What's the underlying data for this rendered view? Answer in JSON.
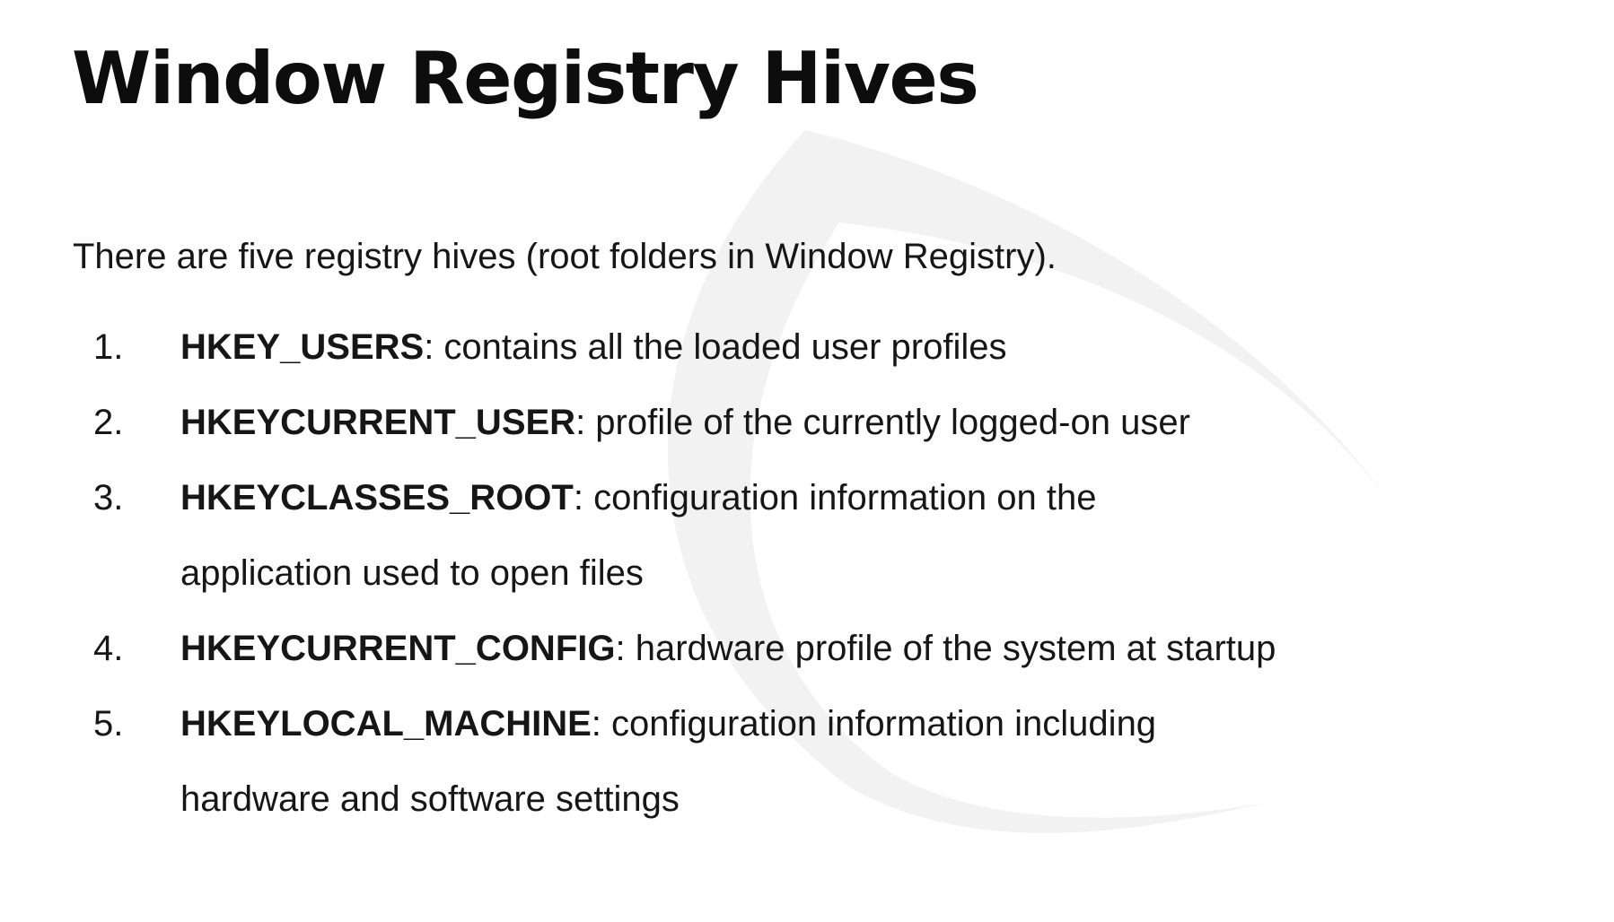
{
  "slide": {
    "title": "Window Registry Hives",
    "intro": "There are five registry hives (root folders in Window Registry).",
    "hives": [
      {
        "number": "1.",
        "key": "HKEY_USERS",
        "description": ": contains all the loaded user profiles"
      },
      {
        "number": "2.",
        "key": "HKEYCURRENT_USER",
        "description": ": profile of the currently logged-on user"
      },
      {
        "number": "3.",
        "key": "HKEYCLASSES_ROOT",
        "description": ": configuration information on the application used to open files"
      },
      {
        "number": "4.",
        "key": "HKEYCURRENT_CONFIG",
        "description": ": hardware profile of the system at startup"
      },
      {
        "number": "5.",
        "key": "HKEYLOCAL_MACHINE",
        "description": ": configuration information including hardware and software settings"
      }
    ]
  },
  "colors": {
    "text": "#161616",
    "title": "#0d0d0d",
    "watermark": "#f2f2f2",
    "background": "#ffffff"
  },
  "decor": {
    "watermark_icon": "swoosh-icon"
  }
}
